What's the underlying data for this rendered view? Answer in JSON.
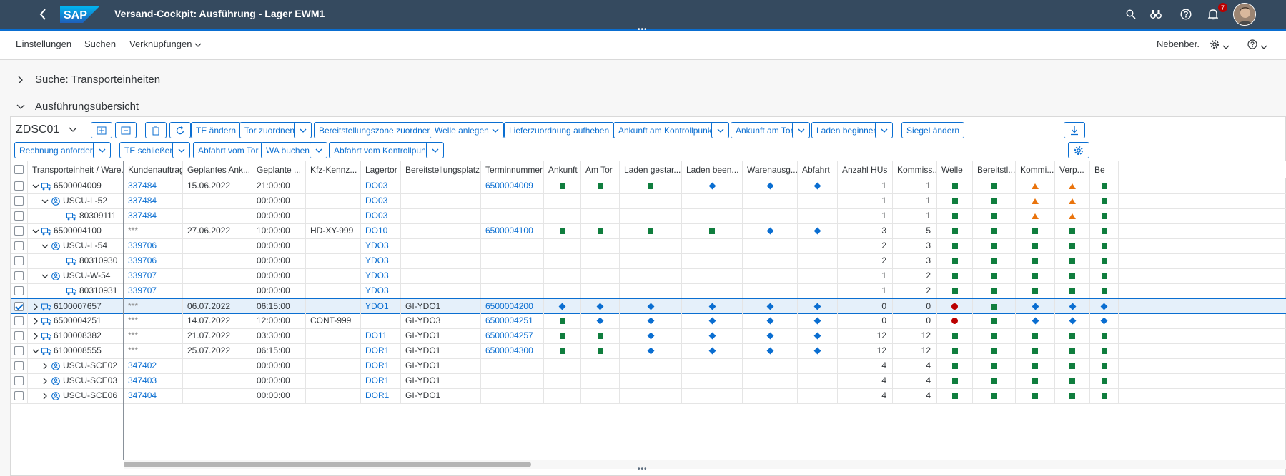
{
  "shell": {
    "title": "Versand-Cockpit: Ausführung - Lager EWM1",
    "logo_text": "SAP",
    "notification_count": "7"
  },
  "header": {
    "menu": [
      "Einstellungen",
      "Suchen",
      "Verknüpfungen"
    ],
    "right_label": "Nebenber."
  },
  "sections": {
    "search": "Suche: Transporteinheiten",
    "overview": "Ausführungsübersicht"
  },
  "toolbar": {
    "variant": "ZDSC01",
    "row1": [
      "TE ändern",
      "Tor zuordnen",
      "Bereitstellungszone zuordnen",
      "Welle anlegen",
      "Lieferzuordnung aufheben",
      "Ankunft am Kontrollpunkt",
      "Ankunft am Tor",
      "Laden beginnen",
      "Siegel ändern"
    ],
    "row2": [
      "Rechnung anfordern",
      "TE schließen",
      "Abfahrt vom Tor",
      "WA buchen",
      "Abfahrt vom Kontrollpunkt"
    ]
  },
  "columns": [
    "Transporteinheit / Ware...",
    "Kundenauftrag",
    "Geplantes Ank...",
    "Geplante ...",
    "Kfz-Kennz...",
    "Lagertor",
    "Bereitstellungsplatz",
    "Terminnummer",
    "Ankunft",
    "Am Tor",
    "Laden gestar...",
    "Laden been...",
    "Warenausg...",
    "Abfahrt",
    "Anzahl HUs",
    "Kommiss...",
    "Welle",
    "Bereitstl...",
    "Kommi...",
    "Verp...",
    "Be"
  ],
  "rows": [
    {
      "level": 0,
      "exp": "down",
      "icon": "truck",
      "id": "6500004009",
      "order": "337484",
      "date": "15.06.2022",
      "time": "21:00:00",
      "plate": "",
      "door": "DO03",
      "zone": "",
      "term": "6500004009",
      "st": [
        "sq",
        "sq",
        "sq",
        "dia",
        "dia",
        "dia"
      ],
      "hus": "1",
      "komm": "1",
      "st2": [
        "sq",
        "sq",
        "tri",
        "tri",
        "sq"
      ]
    },
    {
      "level": 1,
      "exp": "down",
      "icon": "person",
      "id": "USCU-L-52",
      "order": "337484",
      "date": "",
      "time": "00:00:00",
      "plate": "",
      "door": "DO03",
      "zone": "",
      "term": "",
      "st": [
        "",
        "",
        "",
        "",
        "",
        ""
      ],
      "hus": "1",
      "komm": "1",
      "st2": [
        "sq",
        "sq",
        "tri",
        "tri",
        "sq"
      ]
    },
    {
      "level": 2,
      "exp": "",
      "icon": "truck",
      "id": "80309111",
      "order": "337484",
      "date": "",
      "time": "00:00:00",
      "plate": "",
      "door": "DO03",
      "zone": "",
      "term": "",
      "st": [
        "",
        "",
        "",
        "",
        "",
        ""
      ],
      "hus": "1",
      "komm": "1",
      "st2": [
        "sq",
        "sq",
        "tri",
        "tri",
        "sq"
      ]
    },
    {
      "level": 0,
      "exp": "down",
      "icon": "truck",
      "id": "6500004100",
      "order": "***",
      "date": "27.06.2022",
      "time": "10:00:00",
      "plate": "HD-XY-999",
      "door": "DO10",
      "zone": "",
      "term": "6500004100",
      "st": [
        "sq",
        "sq",
        "sq",
        "sq",
        "dia",
        "dia"
      ],
      "hus": "3",
      "komm": "5",
      "st2": [
        "sq",
        "sq",
        "sq",
        "sq",
        "sq"
      ]
    },
    {
      "level": 1,
      "exp": "down",
      "icon": "person",
      "id": "USCU-L-54",
      "order": "339706",
      "date": "",
      "time": "00:00:00",
      "plate": "",
      "door": "YDO3",
      "zone": "",
      "term": "",
      "st": [
        "",
        "",
        "",
        "",
        "",
        ""
      ],
      "hus": "2",
      "komm": "3",
      "st2": [
        "sq",
        "sq",
        "sq",
        "sq",
        "sq"
      ]
    },
    {
      "level": 2,
      "exp": "",
      "icon": "truck",
      "id": "80310930",
      "order": "339706",
      "date": "",
      "time": "00:00:00",
      "plate": "",
      "door": "YDO3",
      "zone": "",
      "term": "",
      "st": [
        "",
        "",
        "",
        "",
        "",
        ""
      ],
      "hus": "2",
      "komm": "3",
      "st2": [
        "sq",
        "sq",
        "sq",
        "sq",
        "sq"
      ]
    },
    {
      "level": 1,
      "exp": "down",
      "icon": "person",
      "id": "USCU-W-54",
      "order": "339707",
      "date": "",
      "time": "00:00:00",
      "plate": "",
      "door": "YDO3",
      "zone": "",
      "term": "",
      "st": [
        "",
        "",
        "",
        "",
        "",
        ""
      ],
      "hus": "1",
      "komm": "2",
      "st2": [
        "sq",
        "sq",
        "sq",
        "sq",
        "sq"
      ]
    },
    {
      "level": 2,
      "exp": "",
      "icon": "truck",
      "id": "80310931",
      "order": "339707",
      "date": "",
      "time": "00:00:00",
      "plate": "",
      "door": "YDO3",
      "zone": "",
      "term": "",
      "st": [
        "",
        "",
        "",
        "",
        "",
        ""
      ],
      "hus": "1",
      "komm": "2",
      "st2": [
        "sq",
        "sq",
        "sq",
        "sq",
        "sq"
      ]
    },
    {
      "level": 0,
      "exp": "right",
      "icon": "truck",
      "id": "6100007657",
      "order": "***",
      "date": "06.07.2022",
      "time": "06:15:00",
      "plate": "",
      "door": "YDO1",
      "zone": "GI-YDO1",
      "term": "6500004200",
      "st": [
        "dia",
        "dia",
        "dia",
        "dia",
        "dia",
        "dia"
      ],
      "hus": "0",
      "komm": "0",
      "st2": [
        "dot",
        "sq",
        "dia",
        "dia",
        "dia"
      ],
      "selected": true
    },
    {
      "level": 0,
      "exp": "right",
      "icon": "truck",
      "id": "6500004251",
      "order": "***",
      "date": "14.07.2022",
      "time": "12:00:00",
      "plate": "CONT-999",
      "door": "",
      "zone": "GI-YDO3",
      "term": "6500004251",
      "st": [
        "sq",
        "dia",
        "dia",
        "dia",
        "dia",
        "dia"
      ],
      "hus": "0",
      "komm": "0",
      "st2": [
        "dot",
        "sq",
        "dia",
        "dia",
        "dia"
      ]
    },
    {
      "level": 0,
      "exp": "right",
      "icon": "truck",
      "id": "6100008382",
      "order": "***",
      "date": "21.07.2022",
      "time": "03:30:00",
      "plate": "",
      "door": "DO11",
      "zone": "GI-YDO1",
      "term": "6500004257",
      "st": [
        "sq",
        "sq",
        "dia",
        "dia",
        "dia",
        "dia"
      ],
      "hus": "12",
      "komm": "12",
      "st2": [
        "sq",
        "sq",
        "sq",
        "sq",
        "sq"
      ]
    },
    {
      "level": 0,
      "exp": "down",
      "icon": "truck",
      "id": "6100008555",
      "order": "***",
      "date": "25.07.2022",
      "time": "06:15:00",
      "plate": "",
      "door": "DOR1",
      "zone": "GI-YDO1",
      "term": "6500004300",
      "st": [
        "sq",
        "sq",
        "dia",
        "dia",
        "dia",
        "dia"
      ],
      "hus": "12",
      "komm": "12",
      "st2": [
        "sq",
        "sq",
        "sq",
        "sq",
        "sq"
      ]
    },
    {
      "level": 1,
      "exp": "right",
      "icon": "person",
      "id": "USCU-SCE02",
      "order": "347402",
      "date": "",
      "time": "00:00:00",
      "plate": "",
      "door": "DOR1",
      "zone": "GI-YDO1",
      "term": "",
      "st": [
        "",
        "",
        "",
        "",
        "",
        ""
      ],
      "hus": "4",
      "komm": "4",
      "st2": [
        "sq",
        "sq",
        "sq",
        "sq",
        "sq"
      ]
    },
    {
      "level": 1,
      "exp": "right",
      "icon": "person",
      "id": "USCU-SCE03",
      "order": "347403",
      "date": "",
      "time": "00:00:00",
      "plate": "",
      "door": "DOR1",
      "zone": "GI-YDO1",
      "term": "",
      "st": [
        "",
        "",
        "",
        "",
        "",
        ""
      ],
      "hus": "4",
      "komm": "4",
      "st2": [
        "sq",
        "sq",
        "sq",
        "sq",
        "sq"
      ]
    },
    {
      "level": 1,
      "exp": "right",
      "icon": "person",
      "id": "USCU-SCE06",
      "order": "347404",
      "date": "",
      "time": "00:00:00",
      "plate": "",
      "door": "DOR1",
      "zone": "GI-YDO1",
      "term": "",
      "st": [
        "",
        "",
        "",
        "",
        "",
        ""
      ],
      "hus": "4",
      "komm": "4",
      "st2": [
        "sq",
        "sq",
        "sq",
        "sq",
        "sq"
      ]
    }
  ],
  "colors": {
    "shell": "#354a5f",
    "accent": "#0a6ed1",
    "positive": "#107e3e",
    "warning": "#e9730c",
    "negative": "#bb0000"
  }
}
